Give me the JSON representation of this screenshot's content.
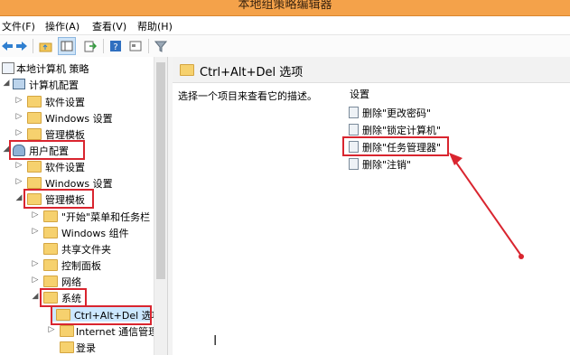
{
  "window": {
    "title": "本地组策略编辑器"
  },
  "menu": [
    "文件(F)",
    "操作(A)",
    "查看(V)",
    "帮助(H)"
  ],
  "toolbar": [
    "back-icon",
    "forward-icon",
    "up-folder-icon",
    "show-tree-icon",
    "export-icon",
    "help-icon",
    "properties-icon",
    "filter-icon"
  ],
  "tree": {
    "root": "本地计算机 策略",
    "computer_config": "计算机配置",
    "c_software": "软件设置",
    "c_windows": "Windows 设置",
    "c_admin": "管理模板",
    "user_config": "用户配置",
    "u_software": "软件设置",
    "u_windows": "Windows 设置",
    "u_admin": "管理模板",
    "start_menu": "\"开始\"菜单和任务栏",
    "win_components": "Windows 组件",
    "shared_folders": "共享文件夹",
    "control_panel": "控制面板",
    "network": "网络",
    "system": "系统",
    "cad_options": "Ctrl+Alt+Del 选项",
    "internet_comm": "Internet 通信管理",
    "logon": "登录"
  },
  "right_pane": {
    "header": "Ctrl+Alt+Del 选项",
    "description": "选择一个项目来查看它的描述。",
    "column": "设置",
    "settings": [
      "删除\"更改密码\"",
      "删除\"锁定计算机\"",
      "删除\"任务管理器\"",
      "删除\"注销\""
    ]
  },
  "colors": {
    "titlebar": "#f4a24a",
    "highlight": "#d9252f",
    "selection": "#cce8ff"
  }
}
